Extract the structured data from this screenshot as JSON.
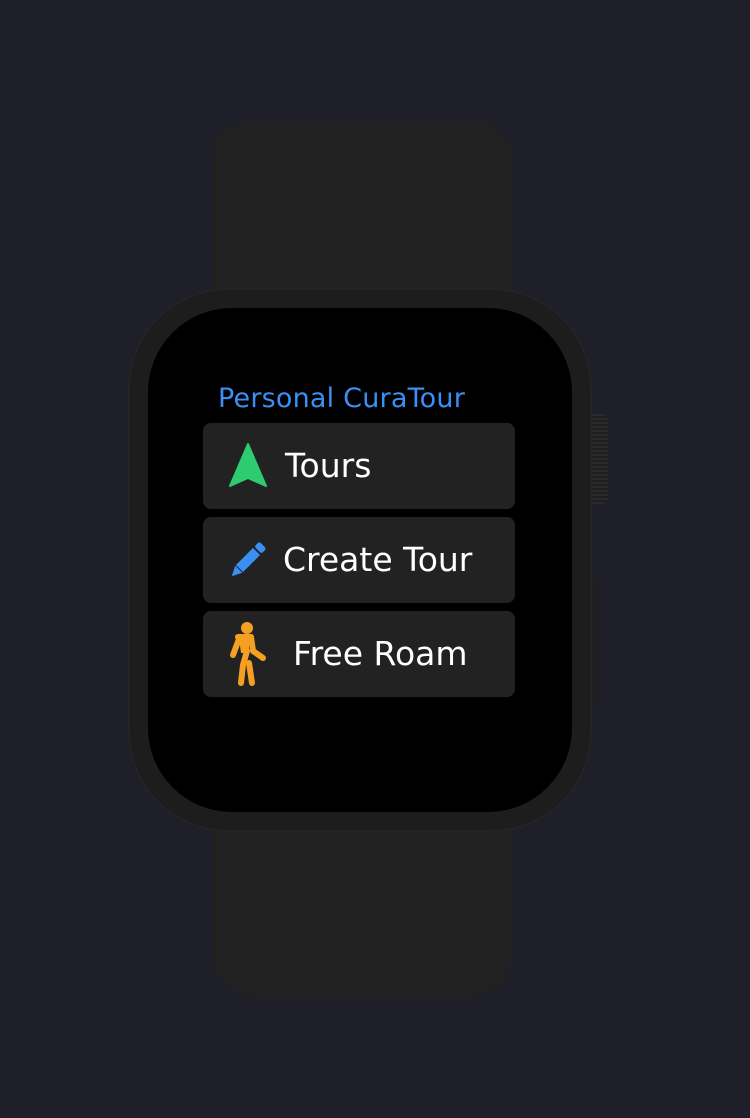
{
  "app": {
    "title": "Personal CuraTour"
  },
  "menu": {
    "items": [
      {
        "label": "Tours",
        "icon": "navigation-arrow-icon",
        "color": "#2ecc71"
      },
      {
        "label": "Create Tour",
        "icon": "pencil-icon",
        "color": "#3b8ff3"
      },
      {
        "label": "Free Roam",
        "icon": "walking-person-icon",
        "color": "#f5a023"
      }
    ]
  },
  "colors": {
    "background": "#1e1f29",
    "screen": "#000000",
    "button": "#222222",
    "title": "#3b8ff3"
  }
}
